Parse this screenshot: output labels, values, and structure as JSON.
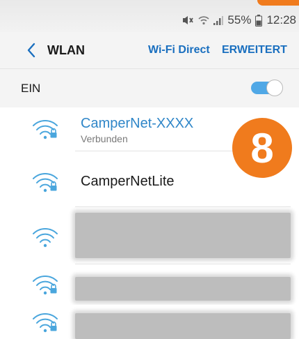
{
  "status_bar": {
    "battery": "55%",
    "time": "12:28",
    "icons": [
      "mute-icon",
      "wifi-status-icon",
      "signal-icon",
      "battery-icon"
    ]
  },
  "app_bar": {
    "title": "WLAN",
    "tabs": [
      "Wi-Fi Direct",
      "ERWEITERT"
    ]
  },
  "master_switch": {
    "label": "EIN",
    "state": "on"
  },
  "networks": [
    {
      "name": "CamperNet-XXXX",
      "status": "Verbunden",
      "connected": true,
      "secured": true
    },
    {
      "name": "CamperNetLite",
      "status": "",
      "connected": false,
      "secured": true
    },
    {
      "name": "",
      "status": "",
      "connected": false,
      "secured": false,
      "redacted": true
    },
    {
      "name": "",
      "status": "",
      "connected": false,
      "secured": true,
      "redacted": true
    },
    {
      "name": "",
      "status": "",
      "connected": false,
      "secured": true,
      "redacted": true
    }
  ],
  "annotation": {
    "step_number": "8"
  },
  "colors": {
    "accent": "#1a6fbf",
    "wifi_icon": "#4aa6dd",
    "connected_text": "#2f86c8",
    "toggle_on": "#50a8e6",
    "badge": "#f07b1d"
  }
}
